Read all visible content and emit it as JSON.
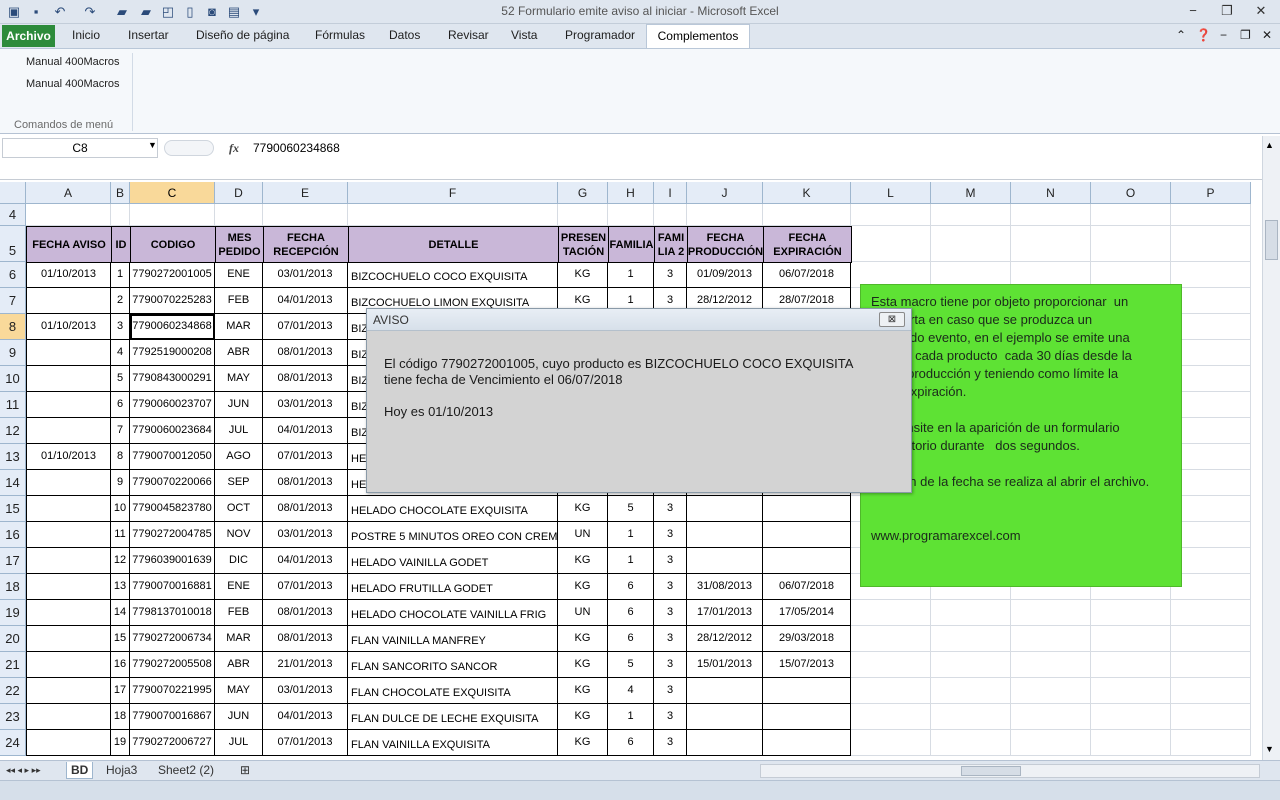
{
  "window": {
    "title": "52 Formulario emite aviso al iniciar  -  Microsoft Excel"
  },
  "ribbon": {
    "file_tab": "Archivo",
    "tabs": [
      "Inicio",
      "Insertar",
      "Diseño de página",
      "Fórmulas",
      "Datos",
      "Revisar",
      "Vista",
      "Programador"
    ],
    "active_tab": "Complementos",
    "items": [
      "Manual 400Macros",
      "Manual 400Macros"
    ],
    "group_label": "Comandos de menú"
  },
  "formula_bar": {
    "name_box": "C8",
    "fx": "fx",
    "value": "7790060234868"
  },
  "grid": {
    "columns": [
      "A",
      "B",
      "C",
      "D",
      "E",
      "F",
      "G",
      "H",
      "I",
      "J",
      "K",
      "L",
      "M",
      "N",
      "O",
      "P"
    ],
    "selected_column": "C",
    "rows": [
      "4",
      "5",
      "6",
      "7",
      "8",
      "9",
      "10",
      "11",
      "12",
      "13",
      "14",
      "15",
      "16",
      "17",
      "18",
      "19",
      "20",
      "21",
      "22",
      "23",
      "24"
    ],
    "selected_row": "8",
    "headers": [
      "FECHA  AVISO",
      "ID",
      "CODIGO",
      "MES PEDIDO",
      "FECHA RECEPCIÓN",
      "DETALLE",
      "PRESEN TACIÓN",
      "FAMILIA",
      "FAMI LIA 2",
      "FECHA PRODUCCIÓN",
      "FECHA EXPIRACIÓN"
    ],
    "data": [
      [
        "01/10/2013",
        "1",
        "7790272001005",
        "ENE",
        "03/01/2013",
        "BIZCOCHUELO COCO EXQUISITA",
        "KG",
        "1",
        "3",
        "01/09/2013",
        "06/07/2018"
      ],
      [
        "",
        "2",
        "7790070225283",
        "FEB",
        "04/01/2013",
        "BIZCOCHUELO LIMON EXQUISITA",
        "KG",
        "1",
        "3",
        "28/12/2012",
        "28/07/2018"
      ],
      [
        "01/10/2013",
        "3",
        "7790060234868",
        "MAR",
        "07/01/2013",
        "BIZ",
        "",
        "",
        "",
        "",
        ""
      ],
      [
        "",
        "4",
        "7792519000208",
        "ABR",
        "08/01/2013",
        "BIZ",
        "",
        "",
        "",
        "",
        ""
      ],
      [
        "",
        "5",
        "7790843000291",
        "MAY",
        "08/01/2013",
        "BIZ",
        "",
        "",
        "",
        "",
        ""
      ],
      [
        "",
        "6",
        "7790060023707",
        "JUN",
        "03/01/2013",
        "BIZ",
        "",
        "",
        "",
        "",
        ""
      ],
      [
        "",
        "7",
        "7790060023684",
        "JUL",
        "04/01/2013",
        "BIZ",
        "",
        "",
        "",
        "",
        ""
      ],
      [
        "01/10/2013",
        "8",
        "7790070012050",
        "AGO",
        "07/01/2013",
        "HE",
        "",
        "",
        "",
        "",
        ""
      ],
      [
        "",
        "9",
        "7790070220066",
        "SEP",
        "08/01/2013",
        "HE",
        "",
        "",
        "",
        "",
        ""
      ],
      [
        "",
        "10",
        "7790045823780",
        "OCT",
        "08/01/2013",
        "HELADO CHOCOLATE EXQUISITA",
        "KG",
        "5",
        "3",
        "",
        ""
      ],
      [
        "",
        "11",
        "7790272004785",
        "NOV",
        "03/01/2013",
        "POSTRE 5 MINUTOS OREO CON CREM",
        "UN",
        "1",
        "3",
        "",
        ""
      ],
      [
        "",
        "12",
        "7796039001639",
        "DIC",
        "04/01/2013",
        "HELADO VAINILLA GODET",
        "KG",
        "1",
        "3",
        "",
        ""
      ],
      [
        "",
        "13",
        "7790070016881",
        "ENE",
        "07/01/2013",
        "HELADO FRUTILLA GODET",
        "KG",
        "6",
        "3",
        "31/08/2013",
        "06/07/2018"
      ],
      [
        "",
        "14",
        "7798137010018",
        "FEB",
        "08/01/2013",
        "HELADO CHOCOLATE VAINILLA FRIG",
        "UN",
        "6",
        "3",
        "17/01/2013",
        "17/05/2014"
      ],
      [
        "",
        "15",
        "7790272006734",
        "MAR",
        "08/01/2013",
        "FLAN VAINILLA MANFREY",
        "KG",
        "6",
        "3",
        "28/12/2012",
        "29/03/2018"
      ],
      [
        "",
        "16",
        "7790272005508",
        "ABR",
        "21/01/2013",
        "FLAN SANCORITO SANCOR",
        "KG",
        "5",
        "3",
        "15/01/2013",
        "15/07/2013"
      ],
      [
        "",
        "17",
        "7790070221995",
        "MAY",
        "03/01/2013",
        "FLAN CHOCOLATE EXQUISITA",
        "KG",
        "4",
        "3",
        "",
        ""
      ],
      [
        "",
        "18",
        "7790070016867",
        "JUN",
        "04/01/2013",
        "FLAN DULCE DE LECHE EXQUISITA",
        "KG",
        "1",
        "3",
        "",
        ""
      ],
      [
        "",
        "19",
        "7790272006727",
        "JUL",
        "07/01/2013",
        "FLAN VAINILLA EXQUISITA",
        "KG",
        "6",
        "3",
        "",
        ""
      ]
    ]
  },
  "note": {
    "lines": [
      "Esta macro tiene por objeto proporcionar  un",
      "      alerta en caso que se produzca un",
      "      inado evento, en el ejemplo se emite una",
      "      por cada producto  cada 30 días desde la",
      "      e  producción y teniendo como límite la",
      "      e expiración.",
      "",
      "      consite en la aparición de un formulario",
      "      rdatorio durante   dos segundos.",
      "",
      "      sión de la fecha se realiza al abrir el archivo.",
      "",
      "",
      "www.programarexcel.com"
    ]
  },
  "dialog": {
    "title": "AVISO",
    "close": "⊠",
    "line1": "El código  7790272001005, cuyo producto es BIZCOCHUELO COCO EXQUISITA",
    "line2": "tiene fecha de Vencimiento el 06/07/2018",
    "line3": "Hoy es 01/10/2013"
  },
  "sheets": {
    "tabs": [
      "BD",
      "Hoja3",
      "Sheet2 (2)"
    ],
    "active": "BD"
  },
  "colors": {
    "header_fill": "#c9b7d8",
    "note_fill": "#5ee234",
    "file_tab": "#2d8b3b",
    "selection": "#f9d99a"
  }
}
